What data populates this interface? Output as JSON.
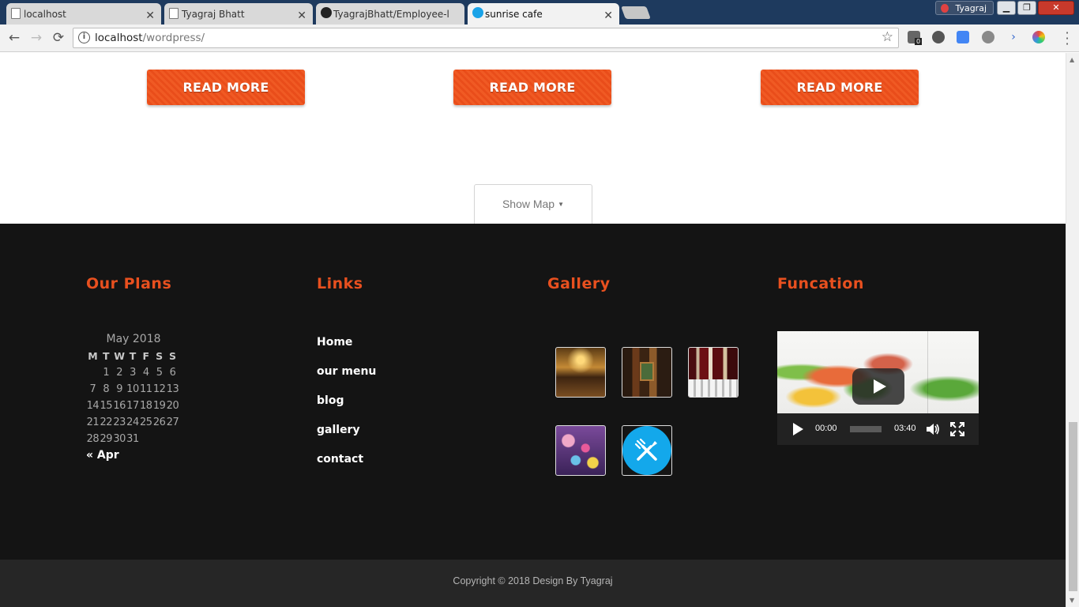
{
  "browser": {
    "tabs": [
      {
        "title": "localhost",
        "icon": "page-icon",
        "active": false
      },
      {
        "title": "Tyagraj Bhatt",
        "icon": "page-icon",
        "active": false
      },
      {
        "title": "TyagrajBhatt/Employee-l",
        "icon": "github-icon",
        "active": false
      },
      {
        "title": "sunrise cafe",
        "icon": "cafe-favicon-icon",
        "active": true
      }
    ],
    "tab_close": "✕",
    "profile_name": "Tyagraj",
    "window_buttons": {
      "minimize": "▁",
      "maximize": "❐",
      "close": "✕"
    },
    "url_host": "localhost",
    "url_path": "/wordpress/",
    "nav": {
      "back": "←",
      "forward": "→",
      "reload": "⟳"
    },
    "star": "☆",
    "extension_badge": "0"
  },
  "page": {
    "read_more_buttons": [
      "READ MORE",
      "READ MORE",
      "READ MORE"
    ],
    "show_map": {
      "label": "Show Map",
      "caret": "▼"
    },
    "footer": {
      "plans": {
        "title": "Our Plans",
        "calendar": {
          "caption": "May 2018",
          "weekdays": [
            "M",
            "T",
            "W",
            "T",
            "F",
            "S",
            "S"
          ],
          "weeks": [
            [
              "",
              "1",
              "2",
              "3",
              "4",
              "5",
              "6"
            ],
            [
              "7",
              "8",
              "9",
              "10",
              "11",
              "12",
              "13"
            ],
            [
              "14",
              "15",
              "16",
              "17",
              "18",
              "19",
              "20"
            ],
            [
              "21",
              "22",
              "23",
              "24",
              "25",
              "26",
              "27"
            ],
            [
              "28",
              "29",
              "30",
              "31",
              "",
              "",
              ""
            ]
          ],
          "prev_link": "« Apr"
        }
      },
      "links": {
        "title": "Links",
        "items": [
          "Home",
          "our menu",
          "blog",
          "gallery",
          "contact"
        ]
      },
      "gallery": {
        "title": "Gallery",
        "images": [
          "gallery-image-1",
          "gallery-image-2",
          "gallery-image-3",
          "gallery-image-4",
          "gallery-image-5"
        ]
      },
      "funcation": {
        "title": "Funcation",
        "video": {
          "current_time": "00:00",
          "duration": "03:40",
          "progress": 0
        }
      }
    },
    "copyright": "Copyright © 2018 Design By Tyagraj"
  },
  "colors": {
    "accent": "#e8501f",
    "footer_bg": "#141414",
    "copyright_bg": "#262626",
    "button": "#f05a24"
  }
}
